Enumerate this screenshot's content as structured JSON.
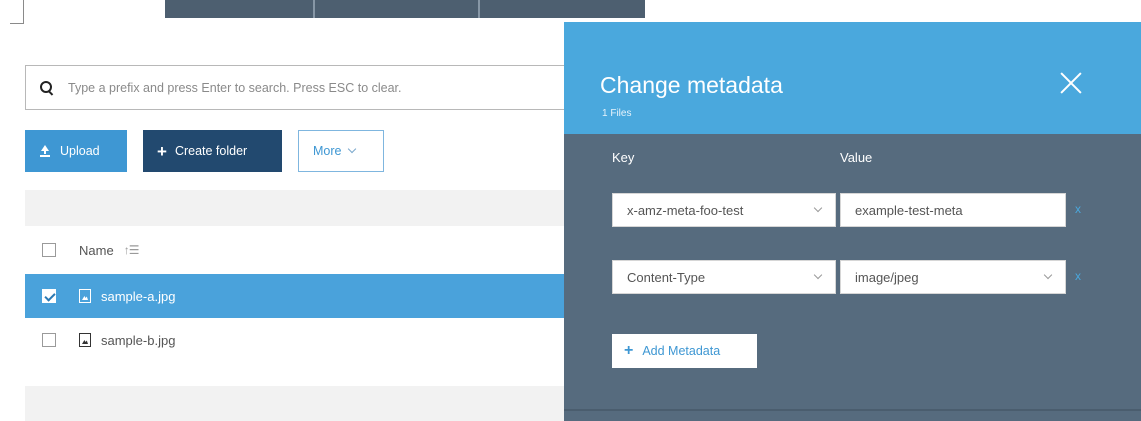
{
  "search": {
    "placeholder": "Type a prefix and press Enter to search. Press ESC to clear."
  },
  "toolbar": {
    "upload_label": "Upload",
    "create_folder_label": "Create folder",
    "more_label": "More"
  },
  "table": {
    "header": {
      "name_label": "Name"
    },
    "rows": [
      {
        "name": "sample-a.jpg",
        "selected": true
      },
      {
        "name": "sample-b.jpg",
        "selected": false
      }
    ]
  },
  "modal": {
    "title": "Change metadata",
    "subtitle": "1 Files",
    "key_label": "Key",
    "value_label": "Value",
    "entries": [
      {
        "key": "x-amz-meta-foo-test",
        "value": "example-test-meta",
        "value_is_dropdown": false
      },
      {
        "key": "Content-Type",
        "value": "image/jpeg",
        "value_is_dropdown": true
      }
    ],
    "add_label": "Add Metadata",
    "remove_glyph": "x"
  },
  "colors": {
    "accent_blue": "#4aa8dd",
    "dark_navy": "#22496f",
    "modal_body": "#566b7e",
    "selected_row": "#4aa2db"
  },
  "icons": [
    "search-icon",
    "upload-icon",
    "plus-icon",
    "chevron-down-icon",
    "sort-icon",
    "file-image-icon",
    "close-icon",
    "checkbox"
  ]
}
